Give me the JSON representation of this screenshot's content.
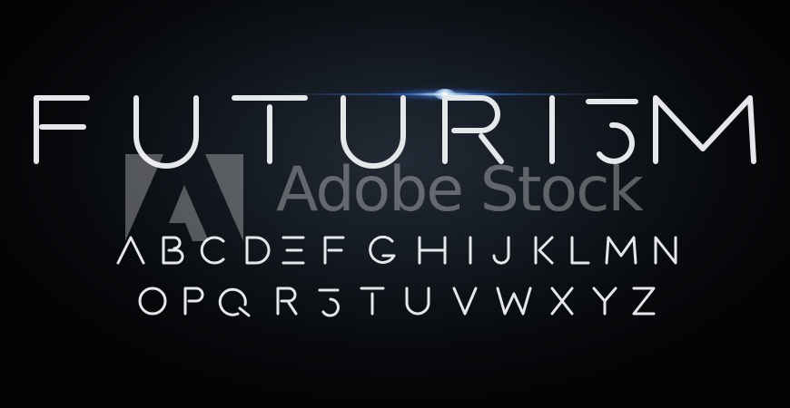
{
  "headline": {
    "text": "FUTURISM",
    "letters": [
      "F",
      "U",
      "T",
      "U",
      "R",
      "I",
      "S",
      "M"
    ]
  },
  "alphabet": {
    "row1": [
      "A",
      "B",
      "C",
      "D",
      "E",
      "F",
      "G",
      "H",
      "I",
      "J",
      "K",
      "L",
      "M",
      "N"
    ],
    "row2": [
      "O",
      "P",
      "Q",
      "R",
      "S",
      "T",
      "U",
      "V",
      "W",
      "X",
      "Y",
      "Z"
    ]
  },
  "watermark": {
    "text": "Adobe Stock",
    "logo_icon": "adobe-logo-icon"
  },
  "colors": {
    "background": "#050608",
    "glyph": "#e6e7ea",
    "flare": "#6fa8ff",
    "watermark": "#8a8a8a"
  }
}
